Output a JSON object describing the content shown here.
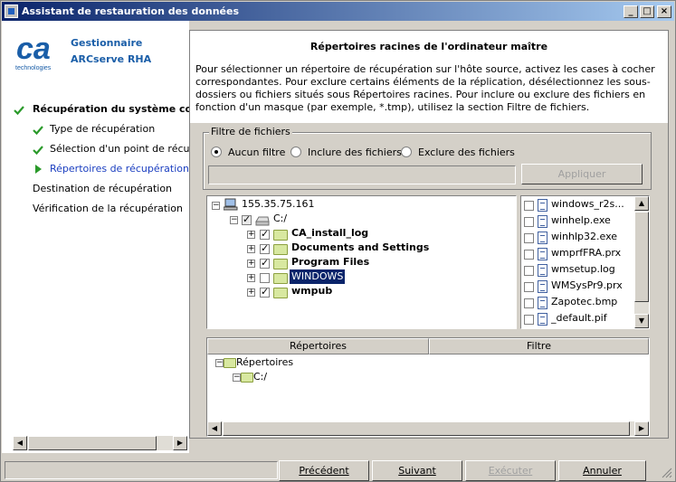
{
  "window": {
    "title": "Assistant de restauration des données"
  },
  "brand": {
    "line1": "Gestionnaire",
    "line2": "ARCserve RHA",
    "logo_letters": "ca",
    "logo_sub": "technologies"
  },
  "steps": [
    {
      "label": "Récupération du système comp",
      "state": "done"
    },
    {
      "label": "Type de récupération",
      "state": "done"
    },
    {
      "label": "Sélection d'un point de récupéra",
      "state": "done"
    },
    {
      "label": "Répertoires de récupération",
      "state": "current"
    },
    {
      "label": "Destination de récupération",
      "state": "pending"
    },
    {
      "label": "Vérification de la récupération",
      "state": "pending"
    }
  ],
  "header": {
    "title": "Répertoires racines de l'ordinateur maître",
    "description": "Pour sélectionner un répertoire de récupération sur l'hôte source, activez les cases à cocher correspondantes. Pour exclure certains éléments de la réplication, désélectionnez les sous-dossiers ou fichiers situés sous Répertoires racines. Pour inclure ou exclure des fichiers en fonction d'un masque (par exemple, *.tmp), utilisez la section Filtre de fichiers."
  },
  "filter": {
    "group_label": "Filtre de fichiers",
    "options": [
      "Aucun filtre",
      "Inclure des fichiers",
      "Exclure des fichiers"
    ],
    "selected": "Aucun filtre",
    "mask_value": "",
    "apply_label": "Appliquer"
  },
  "tree": {
    "host": "155.35.75.161",
    "drive": "C:/",
    "folders": [
      {
        "name": "CA_install_log",
        "checked": true
      },
      {
        "name": "Documents and Settings",
        "checked": true
      },
      {
        "name": "Program Files",
        "checked": true
      },
      {
        "name": "WINDOWS",
        "checked": false
      },
      {
        "name": "wmpub",
        "checked": true
      }
    ]
  },
  "files": [
    "windows_r2s...",
    "winhelp.exe",
    "winhlp32.exe",
    "wmprfFRA.prx",
    "wmsetup.log",
    "WMSysPr9.prx",
    "Zapotec.bmp",
    "_default.pif"
  ],
  "grid": {
    "columns": [
      "Répertoires",
      "Filtre"
    ],
    "root": "Répertoires",
    "child": "C:/"
  },
  "footer": {
    "back": "Précédent",
    "next": "Suivant",
    "run": "Exécuter",
    "cancel": "Annuler"
  },
  "colors": {
    "title_start": "#0a246a",
    "title_end": "#a6caf0",
    "brand": "#1a5ea8",
    "check": "#2a9a2a",
    "current_step": "#1a3ec0"
  },
  "icons": {
    "done": "check-icon",
    "current": "arrow-right-icon"
  }
}
